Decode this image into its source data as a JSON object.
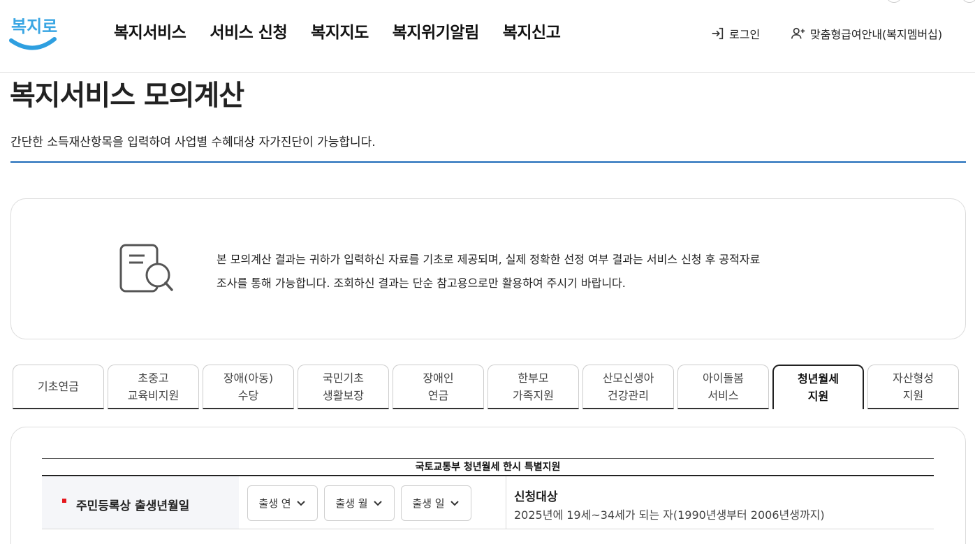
{
  "header": {
    "logo_text": "복지로",
    "nav": [
      "복지서비스",
      "서비스 신청",
      "복지지도",
      "복지위기알림",
      "복지신고"
    ],
    "login_label": "로그인",
    "member_label": "맞춤형급여안내(복지멤버십)"
  },
  "page": {
    "title": "복지서비스 모의계산",
    "description": "간단한 소득재산항목을 입력하여 사업별 수혜대상 자가진단이 가능합니다."
  },
  "notice": {
    "line1": "본 모의계산 결과는 귀하가 입력하신 자료를 기초로 제공되며, 실제 정확한 선정 여부 결과는 서비스 신청 후 공적자료",
    "line2": "조사를 통해 가능합니다. 조회하신 결과는 단순 참고용으로만 활용하여 주시기 바랍니다."
  },
  "tabs": [
    {
      "line1": "기초연금",
      "line2": ""
    },
    {
      "line1": "초중고",
      "line2": "교육비지원"
    },
    {
      "line1": "장애(아동)",
      "line2": "수당"
    },
    {
      "line1": "국민기초",
      "line2": "생활보장"
    },
    {
      "line1": "장애인",
      "line2": "연금"
    },
    {
      "line1": "한부모",
      "line2": "가족지원"
    },
    {
      "line1": "산모신생아",
      "line2": "건강관리"
    },
    {
      "line1": "아이돌봄",
      "line2": "서비스"
    },
    {
      "line1": "청년월세",
      "line2": "지원"
    },
    {
      "line1": "자산형성",
      "line2": "지원"
    }
  ],
  "active_tab_index": 8,
  "form": {
    "caption": "국토교통부 청년월세 한시 특별지원",
    "birth_label": "주민등록상 출생년월일",
    "year_select": "출생 연",
    "month_select": "출생 월",
    "day_select": "출생 일",
    "target_title": "신청대상",
    "target_desc": "2025년에 19세~34세가 되는 자(1990년생부터 2006년생까지)"
  },
  "colors": {
    "accent_blue": "#1c6ab8",
    "required_red": "#e5181e",
    "logo_blue": "#2e9fe0"
  }
}
